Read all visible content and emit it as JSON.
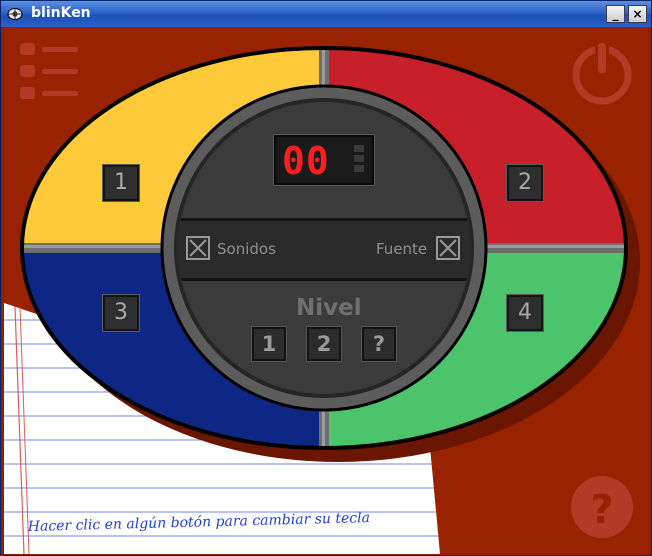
{
  "window": {
    "title": "blinKen",
    "minimize_glyph": "_",
    "close_glyph": "×"
  },
  "colors": {
    "background": "#992300",
    "yellow": "#ffca3a",
    "red": "#c8202a",
    "blue": "#0e2785",
    "green": "#4cc46c",
    "display_digit": "#ff1e1e"
  },
  "game": {
    "counter": "00",
    "sound_label": "Sonidos",
    "font_label": "Fuente",
    "level_heading": "Nivel",
    "levels": [
      "1",
      "2",
      "?"
    ],
    "keys": {
      "yellow": "1",
      "red": "2",
      "blue": "3",
      "green": "4"
    },
    "sound_checked": true,
    "font_checked": true
  },
  "icons": {
    "menu": "menu-list-icon",
    "power": "power-icon",
    "help": "help-icon"
  },
  "note": "Hacer clic en algún botón para cambiar su tecla"
}
